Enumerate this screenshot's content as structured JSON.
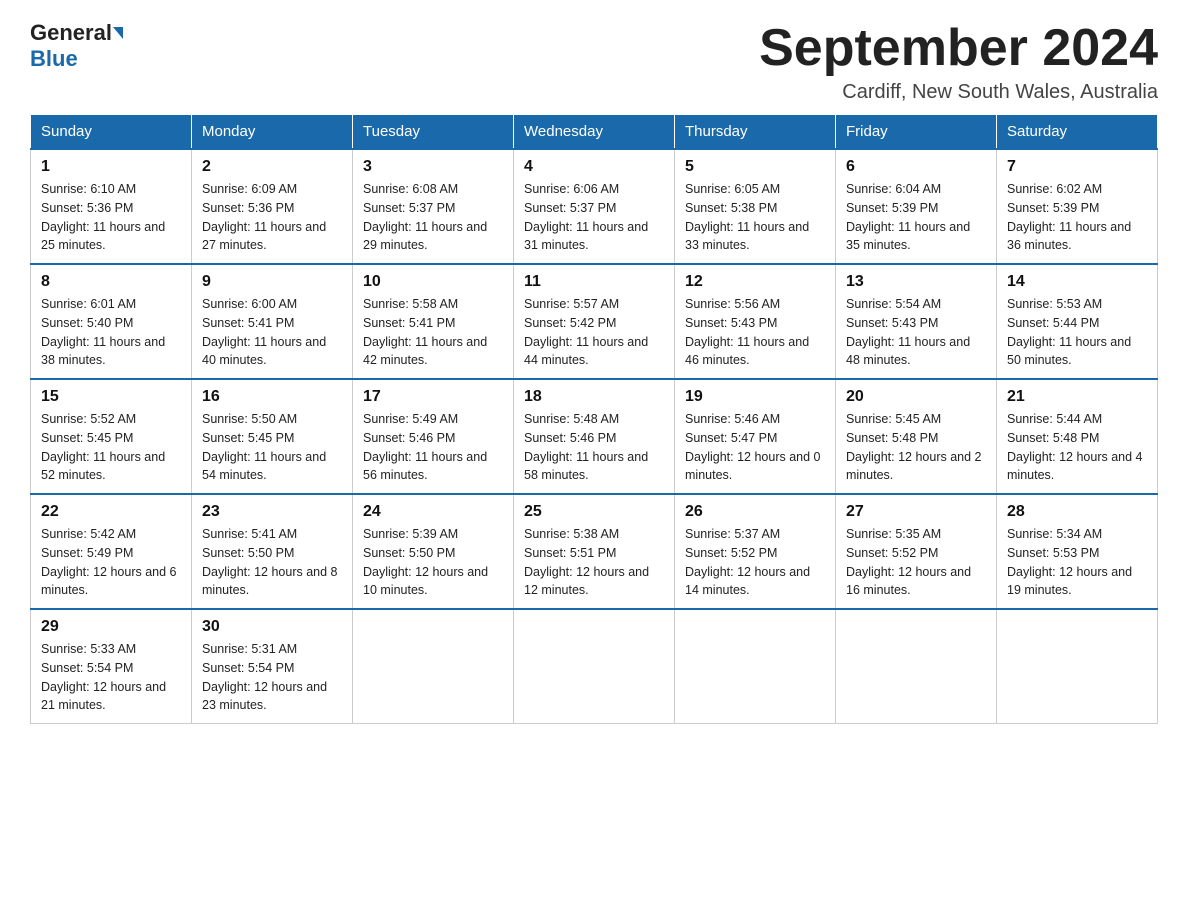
{
  "header": {
    "logo_general": "General",
    "logo_blue": "Blue",
    "month_title": "September 2024",
    "location": "Cardiff, New South Wales, Australia"
  },
  "weekdays": [
    "Sunday",
    "Monday",
    "Tuesday",
    "Wednesday",
    "Thursday",
    "Friday",
    "Saturday"
  ],
  "weeks": [
    [
      {
        "day": "1",
        "sunrise": "Sunrise: 6:10 AM",
        "sunset": "Sunset: 5:36 PM",
        "daylight": "Daylight: 11 hours and 25 minutes."
      },
      {
        "day": "2",
        "sunrise": "Sunrise: 6:09 AM",
        "sunset": "Sunset: 5:36 PM",
        "daylight": "Daylight: 11 hours and 27 minutes."
      },
      {
        "day": "3",
        "sunrise": "Sunrise: 6:08 AM",
        "sunset": "Sunset: 5:37 PM",
        "daylight": "Daylight: 11 hours and 29 minutes."
      },
      {
        "day": "4",
        "sunrise": "Sunrise: 6:06 AM",
        "sunset": "Sunset: 5:37 PM",
        "daylight": "Daylight: 11 hours and 31 minutes."
      },
      {
        "day": "5",
        "sunrise": "Sunrise: 6:05 AM",
        "sunset": "Sunset: 5:38 PM",
        "daylight": "Daylight: 11 hours and 33 minutes."
      },
      {
        "day": "6",
        "sunrise": "Sunrise: 6:04 AM",
        "sunset": "Sunset: 5:39 PM",
        "daylight": "Daylight: 11 hours and 35 minutes."
      },
      {
        "day": "7",
        "sunrise": "Sunrise: 6:02 AM",
        "sunset": "Sunset: 5:39 PM",
        "daylight": "Daylight: 11 hours and 36 minutes."
      }
    ],
    [
      {
        "day": "8",
        "sunrise": "Sunrise: 6:01 AM",
        "sunset": "Sunset: 5:40 PM",
        "daylight": "Daylight: 11 hours and 38 minutes."
      },
      {
        "day": "9",
        "sunrise": "Sunrise: 6:00 AM",
        "sunset": "Sunset: 5:41 PM",
        "daylight": "Daylight: 11 hours and 40 minutes."
      },
      {
        "day": "10",
        "sunrise": "Sunrise: 5:58 AM",
        "sunset": "Sunset: 5:41 PM",
        "daylight": "Daylight: 11 hours and 42 minutes."
      },
      {
        "day": "11",
        "sunrise": "Sunrise: 5:57 AM",
        "sunset": "Sunset: 5:42 PM",
        "daylight": "Daylight: 11 hours and 44 minutes."
      },
      {
        "day": "12",
        "sunrise": "Sunrise: 5:56 AM",
        "sunset": "Sunset: 5:43 PM",
        "daylight": "Daylight: 11 hours and 46 minutes."
      },
      {
        "day": "13",
        "sunrise": "Sunrise: 5:54 AM",
        "sunset": "Sunset: 5:43 PM",
        "daylight": "Daylight: 11 hours and 48 minutes."
      },
      {
        "day": "14",
        "sunrise": "Sunrise: 5:53 AM",
        "sunset": "Sunset: 5:44 PM",
        "daylight": "Daylight: 11 hours and 50 minutes."
      }
    ],
    [
      {
        "day": "15",
        "sunrise": "Sunrise: 5:52 AM",
        "sunset": "Sunset: 5:45 PM",
        "daylight": "Daylight: 11 hours and 52 minutes."
      },
      {
        "day": "16",
        "sunrise": "Sunrise: 5:50 AM",
        "sunset": "Sunset: 5:45 PM",
        "daylight": "Daylight: 11 hours and 54 minutes."
      },
      {
        "day": "17",
        "sunrise": "Sunrise: 5:49 AM",
        "sunset": "Sunset: 5:46 PM",
        "daylight": "Daylight: 11 hours and 56 minutes."
      },
      {
        "day": "18",
        "sunrise": "Sunrise: 5:48 AM",
        "sunset": "Sunset: 5:46 PM",
        "daylight": "Daylight: 11 hours and 58 minutes."
      },
      {
        "day": "19",
        "sunrise": "Sunrise: 5:46 AM",
        "sunset": "Sunset: 5:47 PM",
        "daylight": "Daylight: 12 hours and 0 minutes."
      },
      {
        "day": "20",
        "sunrise": "Sunrise: 5:45 AM",
        "sunset": "Sunset: 5:48 PM",
        "daylight": "Daylight: 12 hours and 2 minutes."
      },
      {
        "day": "21",
        "sunrise": "Sunrise: 5:44 AM",
        "sunset": "Sunset: 5:48 PM",
        "daylight": "Daylight: 12 hours and 4 minutes."
      }
    ],
    [
      {
        "day": "22",
        "sunrise": "Sunrise: 5:42 AM",
        "sunset": "Sunset: 5:49 PM",
        "daylight": "Daylight: 12 hours and 6 minutes."
      },
      {
        "day": "23",
        "sunrise": "Sunrise: 5:41 AM",
        "sunset": "Sunset: 5:50 PM",
        "daylight": "Daylight: 12 hours and 8 minutes."
      },
      {
        "day": "24",
        "sunrise": "Sunrise: 5:39 AM",
        "sunset": "Sunset: 5:50 PM",
        "daylight": "Daylight: 12 hours and 10 minutes."
      },
      {
        "day": "25",
        "sunrise": "Sunrise: 5:38 AM",
        "sunset": "Sunset: 5:51 PM",
        "daylight": "Daylight: 12 hours and 12 minutes."
      },
      {
        "day": "26",
        "sunrise": "Sunrise: 5:37 AM",
        "sunset": "Sunset: 5:52 PM",
        "daylight": "Daylight: 12 hours and 14 minutes."
      },
      {
        "day": "27",
        "sunrise": "Sunrise: 5:35 AM",
        "sunset": "Sunset: 5:52 PM",
        "daylight": "Daylight: 12 hours and 16 minutes."
      },
      {
        "day": "28",
        "sunrise": "Sunrise: 5:34 AM",
        "sunset": "Sunset: 5:53 PM",
        "daylight": "Daylight: 12 hours and 19 minutes."
      }
    ],
    [
      {
        "day": "29",
        "sunrise": "Sunrise: 5:33 AM",
        "sunset": "Sunset: 5:54 PM",
        "daylight": "Daylight: 12 hours and 21 minutes."
      },
      {
        "day": "30",
        "sunrise": "Sunrise: 5:31 AM",
        "sunset": "Sunset: 5:54 PM",
        "daylight": "Daylight: 12 hours and 23 minutes."
      },
      null,
      null,
      null,
      null,
      null
    ]
  ]
}
